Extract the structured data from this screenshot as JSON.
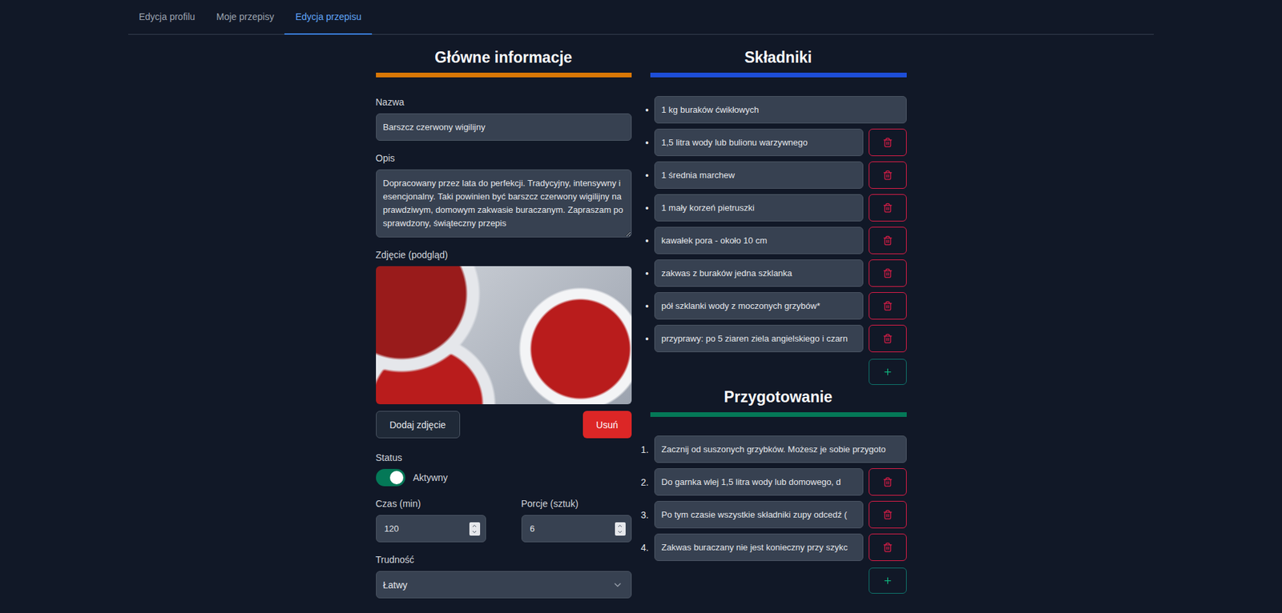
{
  "tabs": [
    {
      "label": "Edycja profilu",
      "selected": false
    },
    {
      "label": "Moje przepisy",
      "selected": false
    },
    {
      "label": "Edycja przepisu",
      "selected": true
    }
  ],
  "main": {
    "heading": "Główne informacje",
    "name": {
      "label": "Nazwa",
      "value": "Barszcz czerwony wigilijny"
    },
    "description": {
      "label": "Opis",
      "value": "Dopracowany przez lata do perfekcji. Tradycyjny, intensywny i esencjonalny. Taki powinien być barszcz czerwony wigilijny na prawdziwym, domowym zakwasie buraczanym. Zapraszam po sprawdzony, świąteczny przepis"
    },
    "photo": {
      "label": "Zdjęcie (podgląd)",
      "add": "Dodaj zdjęcie",
      "remove": "Usuń"
    },
    "status": {
      "label": "Status",
      "on": true,
      "text": "Aktywny"
    },
    "time": {
      "label": "Czas (min)",
      "value": "120"
    },
    "portions": {
      "label": "Porcje (sztuk)",
      "value": "6"
    },
    "difficulty": {
      "label": "Trudność",
      "value": "Łatwy"
    }
  },
  "ingredients": {
    "heading": "Składniki",
    "marker": "•",
    "items": [
      {
        "text": "1 kg buraków ćwikłowych",
        "removable": false
      },
      {
        "text": "1,5 litra wody lub bulionu warzywnego",
        "removable": true
      },
      {
        "text": "1 średnia marchew",
        "removable": true
      },
      {
        "text": "1 mały korzeń pietruszki",
        "removable": true
      },
      {
        "text": "kawałek pora - około 10 cm",
        "removable": true
      },
      {
        "text": "zakwas z buraków jedna szklanka",
        "removable": true
      },
      {
        "text": "pół szklanki wody z moczonych grzybów*",
        "removable": true
      },
      {
        "text": "przyprawy: po 5 ziaren ziela angielskiego i czarn",
        "removable": true
      }
    ]
  },
  "steps": {
    "heading": "Przygotowanie",
    "items": [
      {
        "number": "1.",
        "text": "Zacznij od suszonych grzybków. Możesz je sobie przygoto",
        "removable": false
      },
      {
        "number": "2.",
        "text": "Do garnka wlej 1,5 litra wody lub domowego, d",
        "removable": true
      },
      {
        "number": "3.",
        "text": "Po tym czasie wszystkie składniki zupy odcedź (",
        "removable": true
      },
      {
        "number": "4.",
        "text": "Zakwas buraczany nie jest konieczny przy szykc",
        "removable": true
      }
    ]
  }
}
